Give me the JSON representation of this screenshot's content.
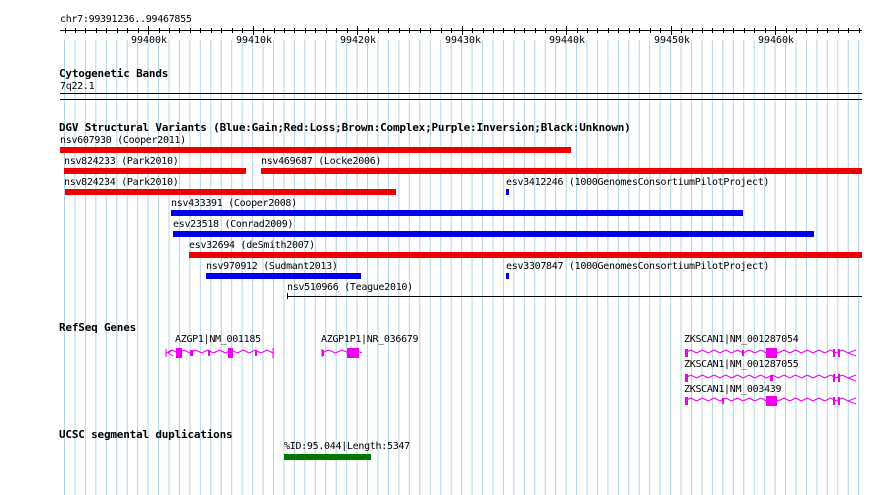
{
  "ruler": {
    "position_label": "chr7:99391236..99467855",
    "ticks": [
      "99400k",
      "99410k",
      "99420k",
      "99430k",
      "99440k",
      "99450k",
      "99460k"
    ]
  },
  "cytoband": {
    "title": "Cytogenetic Bands",
    "band_label": "7q22.1"
  },
  "dgv": {
    "title": "DGV Structural Variants (Blue:Gain;Red:Loss;Brown:Complex;Purple:Inversion;Black:Unknown)",
    "colors": {
      "gain": "#0000ee",
      "loss": "#ee0000",
      "unknown": "#000000"
    },
    "variants": [
      {
        "label": "nsv607930 (Cooper2011)",
        "type": "loss"
      },
      {
        "label": "nsv824233 (Park2010)",
        "type": "loss"
      },
      {
        "label": "nsv469687 (Locke2006)",
        "type": "loss"
      },
      {
        "label": "nsv824234 (Park2010)",
        "type": "loss"
      },
      {
        "label": "esv3412246 (1000GenomesConsortiumPilotProject)",
        "type": "gain"
      },
      {
        "label": "nsv433391 (Cooper2008)",
        "type": "gain"
      },
      {
        "label": "esv23518 (Conrad2009)",
        "type": "gain"
      },
      {
        "label": "esv32694 (deSmith2007)",
        "type": "loss"
      },
      {
        "label": "nsv970912 (Sudmant2013)",
        "type": "gain"
      },
      {
        "label": "esv3307847 (1000GenomesConsortiumPilotProject)",
        "type": "gain"
      },
      {
        "label": "nsv510966 (Teague2010)",
        "type": "unknown"
      }
    ]
  },
  "refseq": {
    "title": "RefSeq Genes",
    "color": "#ee00ee",
    "genes": [
      {
        "label": "AZGP1|NM_001185"
      },
      {
        "label": "AZGP1P1|NR_036679"
      },
      {
        "label": "ZKSCAN1|NM_001287054"
      },
      {
        "label": "ZKSCAN1|NM_001287055"
      },
      {
        "label": "ZKSCAN1|NM_003439"
      }
    ]
  },
  "segdup": {
    "title": "UCSC segmental duplications",
    "color": "#007700",
    "feature_label": "%ID:95.044|Length:5347"
  },
  "grid_color": "#b4d4e4"
}
